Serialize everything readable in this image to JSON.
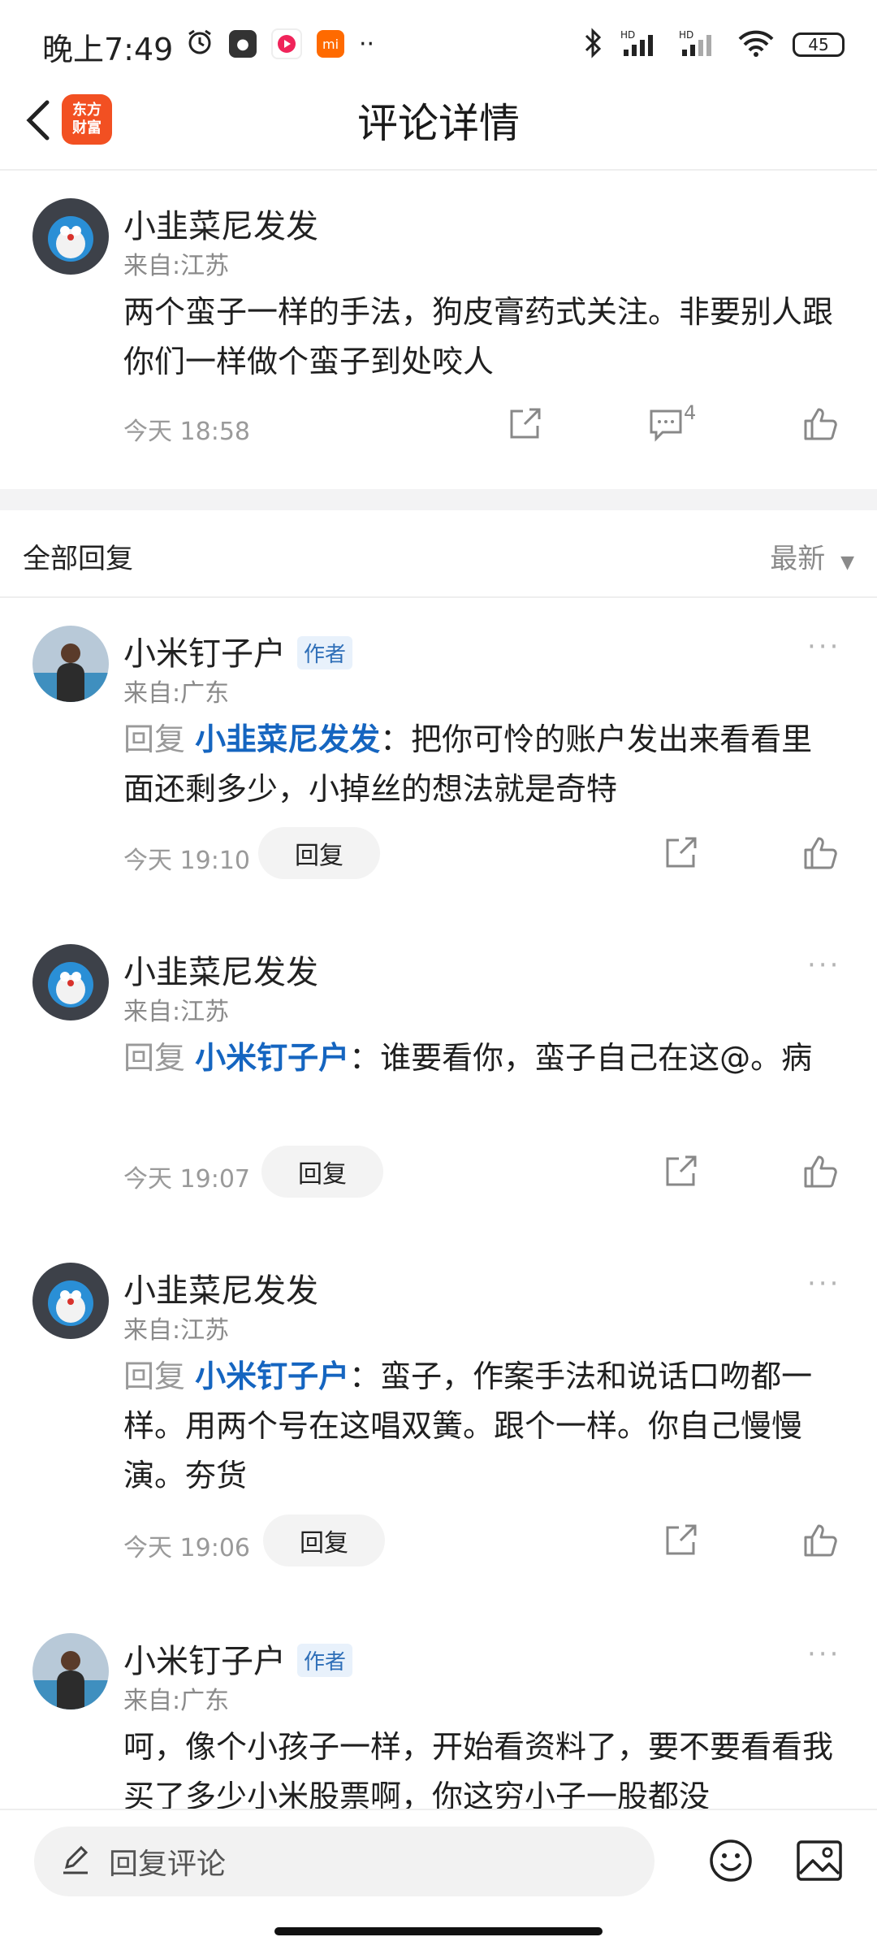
{
  "status_bar": {
    "time": "晚上7:49",
    "battery": "45",
    "signal_label": "HD"
  },
  "header": {
    "title": "评论详情",
    "logo_line1": "东方",
    "logo_line2": "财富"
  },
  "main_comment": {
    "username": "小韭菜尼发发",
    "location": "来自:江苏",
    "text": "两个蛮子一样的手法，狗皮膏药式关注。非要别人跟你们一样做个蛮子到处咬人",
    "time": "今天 18:58",
    "reply_count": "4"
  },
  "replies_section": {
    "title": "全部回复",
    "sort": "最新"
  },
  "replies": [
    {
      "username": "小米钉子户",
      "badge": "作者",
      "location": "来自:广东",
      "reply_prefix": "回复",
      "mention": "小韭菜尼发发",
      "text": "：把你可怜的账户发出来看看里面还剩多少，小掉丝的想法就是奇特",
      "time": "今天 19:10",
      "reply_button": "回复"
    },
    {
      "username": "小韭菜尼发发",
      "location": "来自:江苏",
      "reply_prefix": "回复",
      "mention": "小米钉子户",
      "text": "：谁要看你，蛮子自己在这@。病",
      "time": "今天 19:07",
      "reply_button": "回复"
    },
    {
      "username": "小韭菜尼发发",
      "location": "来自:江苏",
      "reply_prefix": "回复",
      "mention": "小米钉子户",
      "text": "：蛮子，作案手法和说话口吻都一样。用两个号在这唱双簧。跟个一样。你自己慢慢演。夯货",
      "time": "今天 19:06",
      "reply_button": "回复"
    },
    {
      "username": "小米钉子户",
      "badge": "作者",
      "location": "来自:广东",
      "text": "呵，像个小孩子一样，开始看资料了，要不要看看我买了多少小米股票啊，你这穷小子一股都没"
    }
  ],
  "bottom_bar": {
    "input_placeholder": "回复评论"
  }
}
